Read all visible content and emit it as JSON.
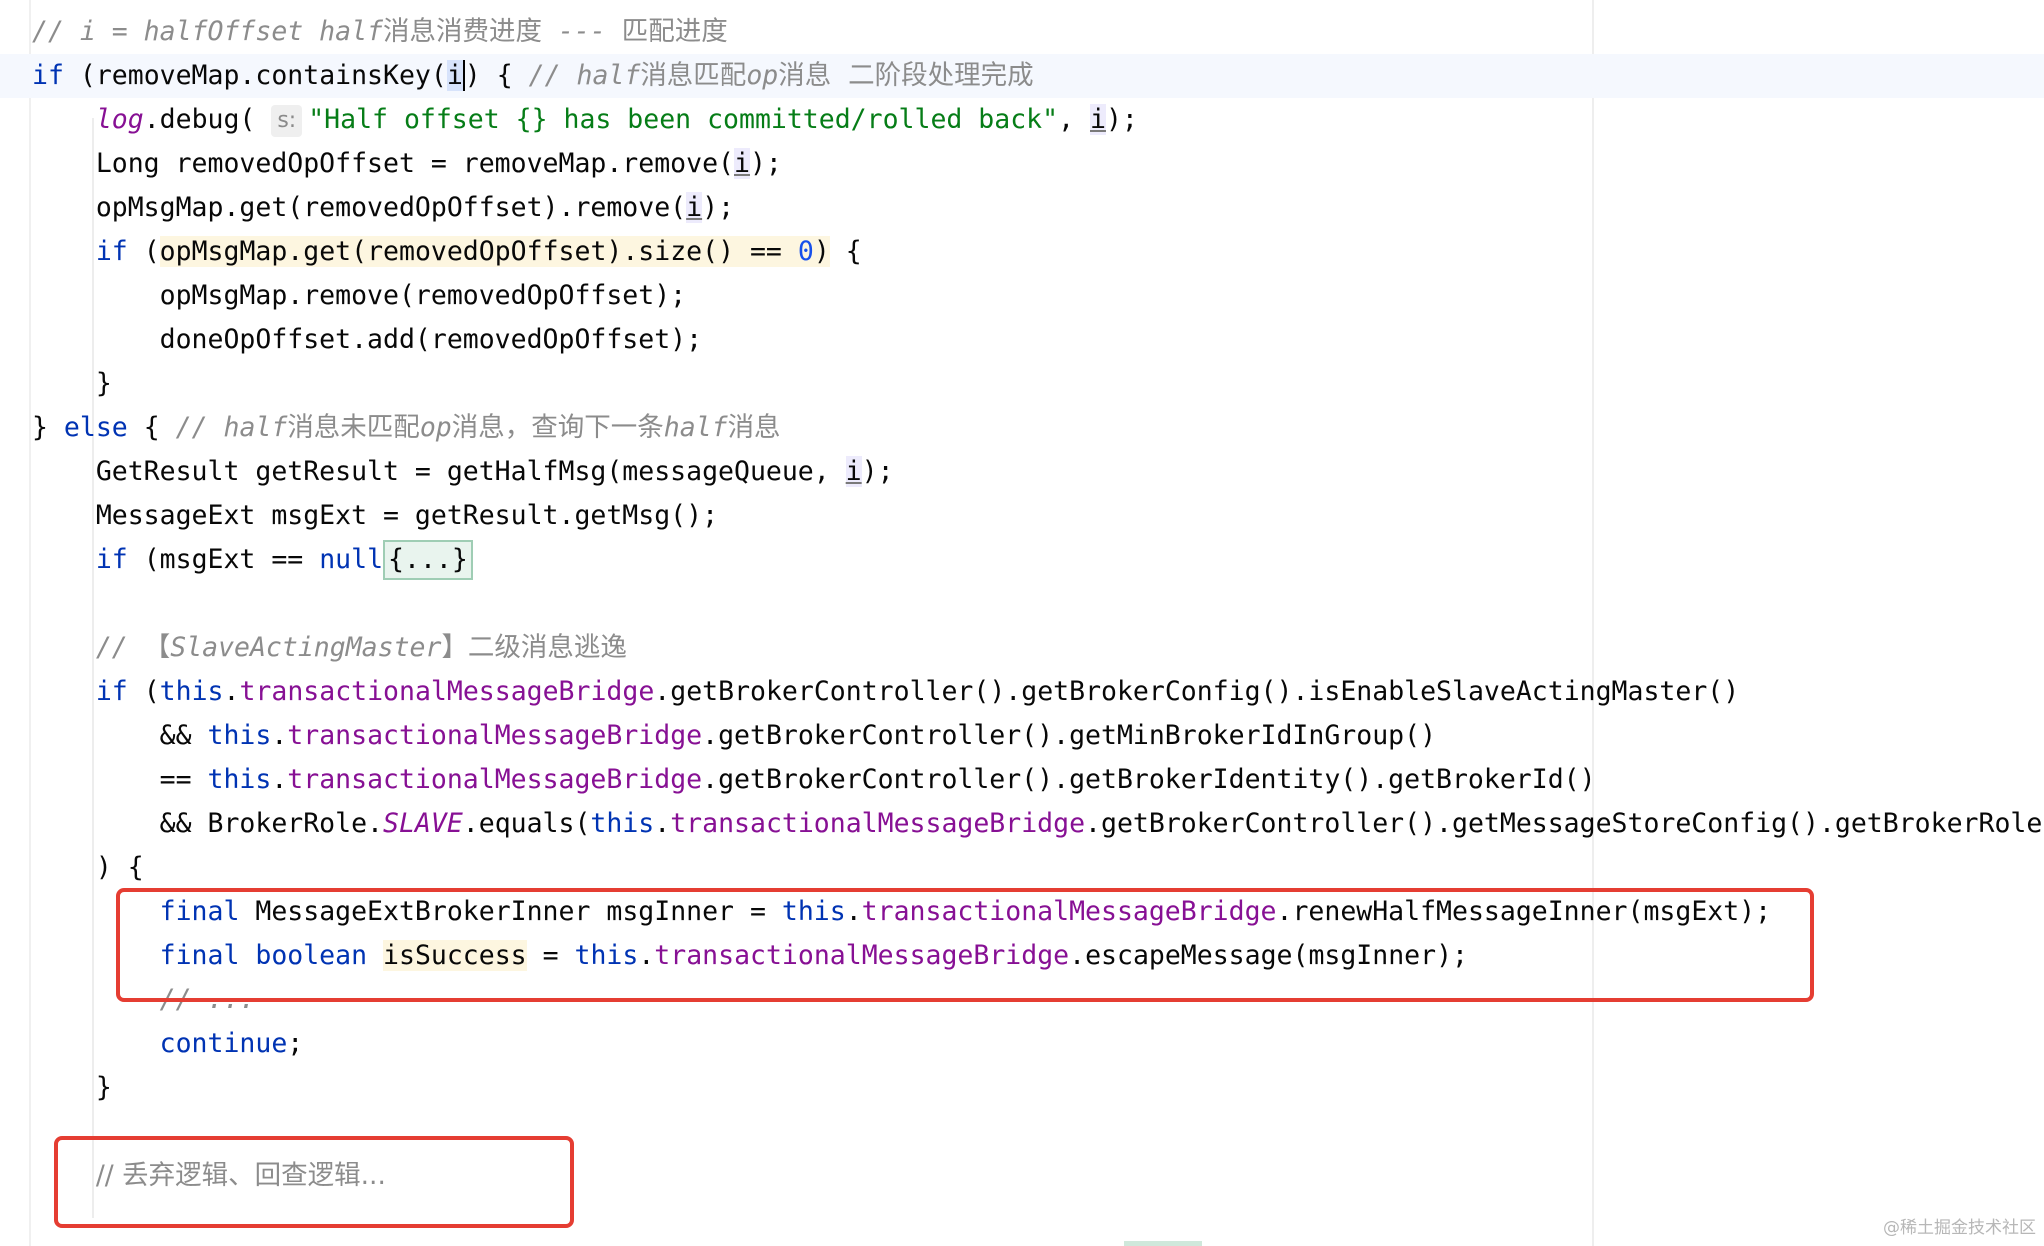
{
  "editor": {
    "lines": [
      {
        "id": "l0",
        "tokens": [
          [
            "cmt",
            "// i = halfOffset half"
          ],
          [
            "cmt-cjk",
            "消息消费进度"
          ],
          [
            "cmt",
            " --- "
          ],
          [
            "cmt-cjk",
            "匹配进度"
          ]
        ]
      },
      {
        "id": "l1",
        "current": true,
        "tokens": [
          [
            "kw",
            "if"
          ],
          [
            "",
            " (removeMap.containsKey("
          ],
          [
            "caret-sel",
            "i"
          ],
          [
            "",
            ") { "
          ],
          [
            "cmt",
            "// half"
          ],
          [
            "cmt-cjk",
            "消息匹配"
          ],
          [
            "cmt",
            "op"
          ],
          [
            "cmt-cjk",
            "消息  二阶段处理完成"
          ]
        ]
      },
      {
        "id": "l2",
        "tokens": [
          [
            "",
            "    "
          ],
          [
            "logv",
            "log"
          ],
          [
            "",
            ".debug( "
          ],
          [
            "hint",
            "s:"
          ],
          [
            "str",
            "\"Half offset {} has been committed/rolled back\""
          ],
          [
            "",
            ", "
          ],
          [
            "uvar",
            "i"
          ],
          [
            "",
            ");"
          ]
        ]
      },
      {
        "id": "l3",
        "tokens": [
          [
            "",
            "    Long removedOpOffset = removeMap.remove("
          ],
          [
            "uvar",
            "i"
          ],
          [
            "",
            ");"
          ]
        ]
      },
      {
        "id": "l4",
        "tokens": [
          [
            "",
            "    opMsgMap.get(removedOpOffset).remove("
          ],
          [
            "uvar",
            "i"
          ],
          [
            "",
            ");"
          ]
        ]
      },
      {
        "id": "l5",
        "tokens": [
          [
            "",
            "    "
          ],
          [
            "kw",
            "if"
          ],
          [
            "",
            " ("
          ],
          [
            "hl-yellow",
            "opMsgMap.get(removedOpOffset).size() == "
          ],
          [
            "num hl-yellow",
            "0"
          ],
          [
            "hl-yellow",
            ")"
          ],
          [
            "",
            " {"
          ]
        ]
      },
      {
        "id": "l6",
        "tokens": [
          [
            "",
            "        opMsgMap.remove(removedOpOffset);"
          ]
        ]
      },
      {
        "id": "l7",
        "tokens": [
          [
            "",
            "        doneOpOffset.add(removedOpOffset);"
          ]
        ]
      },
      {
        "id": "l8",
        "tokens": [
          [
            "",
            "    }"
          ]
        ]
      },
      {
        "id": "l9",
        "tokens": [
          [
            "",
            "} "
          ],
          [
            "kw",
            "else"
          ],
          [
            "",
            " { "
          ],
          [
            "cmt",
            "// half"
          ],
          [
            "cmt-cjk",
            "消息未匹配"
          ],
          [
            "cmt",
            "op"
          ],
          [
            "cmt-cjk",
            "消息，查询下一条"
          ],
          [
            "cmt",
            "half"
          ],
          [
            "cmt-cjk",
            "消息"
          ]
        ]
      },
      {
        "id": "l10",
        "tokens": [
          [
            "",
            "    GetResult getResult = getHalfMsg(messageQueue, "
          ],
          [
            "uvar",
            "i"
          ],
          [
            "",
            ");"
          ]
        ]
      },
      {
        "id": "l11",
        "tokens": [
          [
            "",
            "    MessageExt msgExt = getResult.getMsg();"
          ]
        ]
      },
      {
        "id": "l12",
        "tokens": [
          [
            "",
            "    "
          ],
          [
            "kw",
            "if"
          ],
          [
            "",
            " (msgExt == "
          ],
          [
            "kw",
            "null"
          ],
          [
            ") "
          ],
          [
            "fold",
            "{...}"
          ]
        ]
      },
      {
        "id": "l13",
        "tokens": [
          [
            "",
            ""
          ]
        ]
      },
      {
        "id": "l14",
        "tokens": [
          [
            "",
            "    "
          ],
          [
            "cmt",
            "// "
          ],
          [
            "cmt-cjk",
            "【"
          ],
          [
            "cmt",
            "SlaveActingMaster"
          ],
          [
            "cmt-cjk",
            "】二级消息逃逸"
          ]
        ]
      },
      {
        "id": "l15",
        "tokens": [
          [
            "",
            "    "
          ],
          [
            "kw",
            "if"
          ],
          [
            "",
            " ("
          ],
          [
            "kw",
            "this"
          ],
          [
            "",
            "."
          ],
          [
            "fld",
            "transactionalMessageBridge"
          ],
          [
            "",
            ".getBrokerController().getBrokerConfig().isEnableSlaveActingMaster()"
          ]
        ]
      },
      {
        "id": "l16",
        "tokens": [
          [
            "",
            "        && "
          ],
          [
            "kw",
            "this"
          ],
          [
            "",
            "."
          ],
          [
            "fld",
            "transactionalMessageBridge"
          ],
          [
            "",
            ".getBrokerController().getMinBrokerIdInGroup()"
          ]
        ]
      },
      {
        "id": "l17",
        "tokens": [
          [
            "",
            "        == "
          ],
          [
            "kw",
            "this"
          ],
          [
            "",
            "."
          ],
          [
            "fld",
            "transactionalMessageBridge"
          ],
          [
            "",
            ".getBrokerController().getBrokerIdentity().getBrokerId()"
          ]
        ]
      },
      {
        "id": "l18",
        "tokens": [
          [
            "",
            "        && BrokerRole."
          ],
          [
            "static",
            "SLAVE"
          ],
          [
            "",
            ".equals("
          ],
          [
            "kw",
            "this"
          ],
          [
            "",
            "."
          ],
          [
            "fld",
            "transactionalMessageBridge"
          ],
          [
            "",
            ".getBrokerController().getMessageStoreConfig().getBrokerRole())"
          ]
        ]
      },
      {
        "id": "l19",
        "tokens": [
          [
            "",
            "    ) {"
          ]
        ]
      },
      {
        "id": "l20",
        "tokens": [
          [
            "",
            "        "
          ],
          [
            "kw",
            "final"
          ],
          [
            "",
            " MessageExtBrokerInner msgInner = "
          ],
          [
            "kw",
            "this"
          ],
          [
            "",
            "."
          ],
          [
            "fld",
            "transactionalMessageBridge"
          ],
          [
            "",
            ".renewHalfMessageInner(msgExt);"
          ]
        ]
      },
      {
        "id": "l21",
        "tokens": [
          [
            "",
            "        "
          ],
          [
            "kw",
            "final boolean"
          ],
          [
            "",
            " "
          ],
          [
            "hl-yellow",
            "isSuccess"
          ],
          [
            "",
            " = "
          ],
          [
            "kw",
            "this"
          ],
          [
            "",
            "."
          ],
          [
            "fld",
            "transactionalMessageBridge"
          ],
          [
            "",
            ".escapeMessage(msgInner);"
          ]
        ]
      },
      {
        "id": "l22",
        "tokens": [
          [
            "",
            "        "
          ],
          [
            "cmt",
            "// ..."
          ]
        ]
      },
      {
        "id": "l23",
        "tokens": [
          [
            "",
            "        "
          ],
          [
            "kw",
            "continue"
          ],
          [
            "",
            ";"
          ]
        ]
      },
      {
        "id": "l24",
        "tokens": [
          [
            "",
            "    }"
          ]
        ]
      },
      {
        "id": "l25",
        "tokens": [
          [
            "",
            ""
          ]
        ]
      },
      {
        "id": "l26",
        "tokens": [
          [
            "",
            "    "
          ],
          [
            "cmt-cjk",
            "// 丢弃逻辑、回查逻辑..."
          ]
        ]
      }
    ]
  },
  "watermark": "@稀土掘金技术社区"
}
